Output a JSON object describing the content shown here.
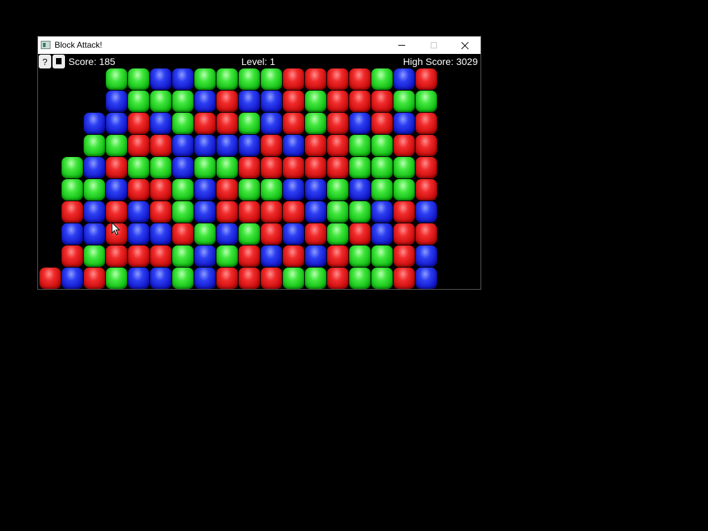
{
  "window": {
    "title": "Block Attack!",
    "icon": "app-icon"
  },
  "hud": {
    "help_label": "?",
    "stop_icon": "stop-square-icon",
    "score_text": "Score: 185",
    "level_text": "Level: 1",
    "highscore_text": "High Score: 3029"
  },
  "colors": {
    "R": "#e01010",
    "G": "#20d020",
    "B": "#1c20d8",
    "background": "#000000",
    "hud_text": "#ffffff"
  },
  "board": {
    "columns": 18,
    "rows_visible": 10,
    "legend": {
      "R": "red",
      "G": "green",
      "B": "blue",
      ".": "empty"
    },
    "grid": [
      "....GGBBGGGGRRRRGBR",
      "....BGGGBRBBRGRRRGG",
      "...BBRBGRRGBRGRBRBR",
      "...GGRRBBBBRBRRGGRR",
      "..GBRGGBGGRRRRRGGGR",
      "..GGBRRGBRGGBBGBGGR",
      "..RBRBRGBRRRRBGGBRB",
      "..BBRBBRGBGRBRGRBRR",
      "..RGRRRGBGRBRBRGGRB",
      ".RBRGBBGBRRRGGRGGRB"
    ]
  }
}
